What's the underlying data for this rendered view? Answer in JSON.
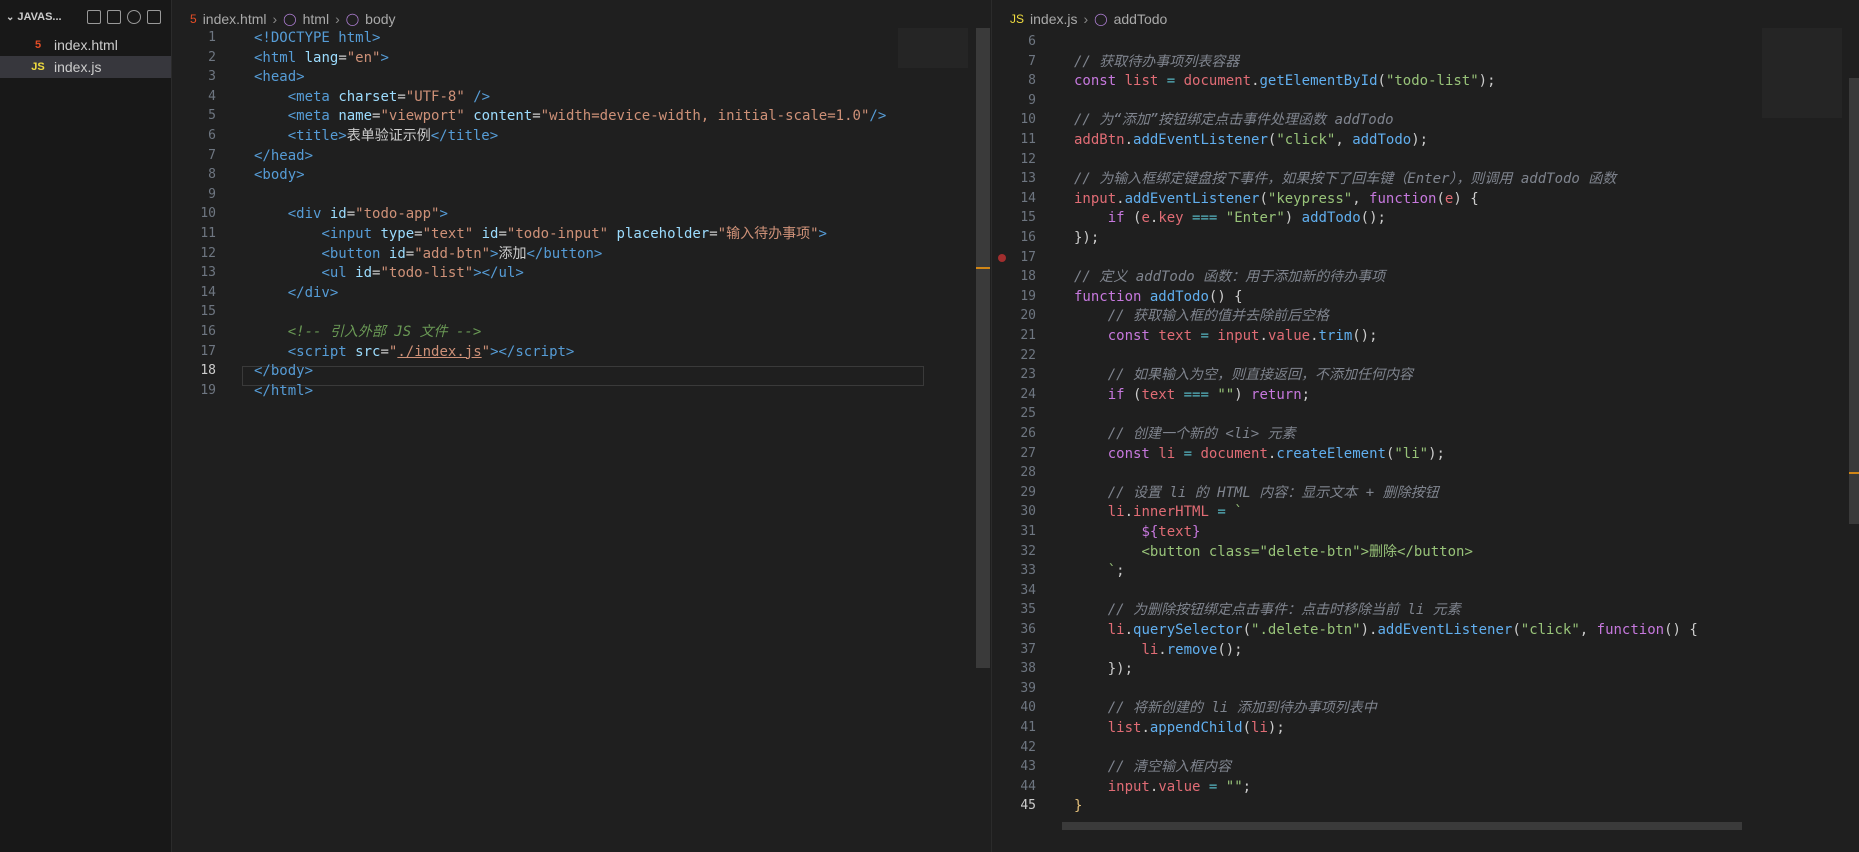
{
  "explorer": {
    "title": "JAVAS...",
    "files": [
      {
        "name": "index.html",
        "icon": "5"
      },
      {
        "name": "index.js",
        "icon": "JS"
      }
    ]
  },
  "left_editor": {
    "breadcrumbs": [
      "index.html",
      "html",
      "body"
    ],
    "current_line": 18
  },
  "right_editor": {
    "breadcrumbs": [
      "index.js",
      "addTodo"
    ],
    "current_line": 45
  },
  "colors": {
    "background": "#1f1f1f",
    "sidebar": "#181818",
    "active_file": "#37373d"
  }
}
